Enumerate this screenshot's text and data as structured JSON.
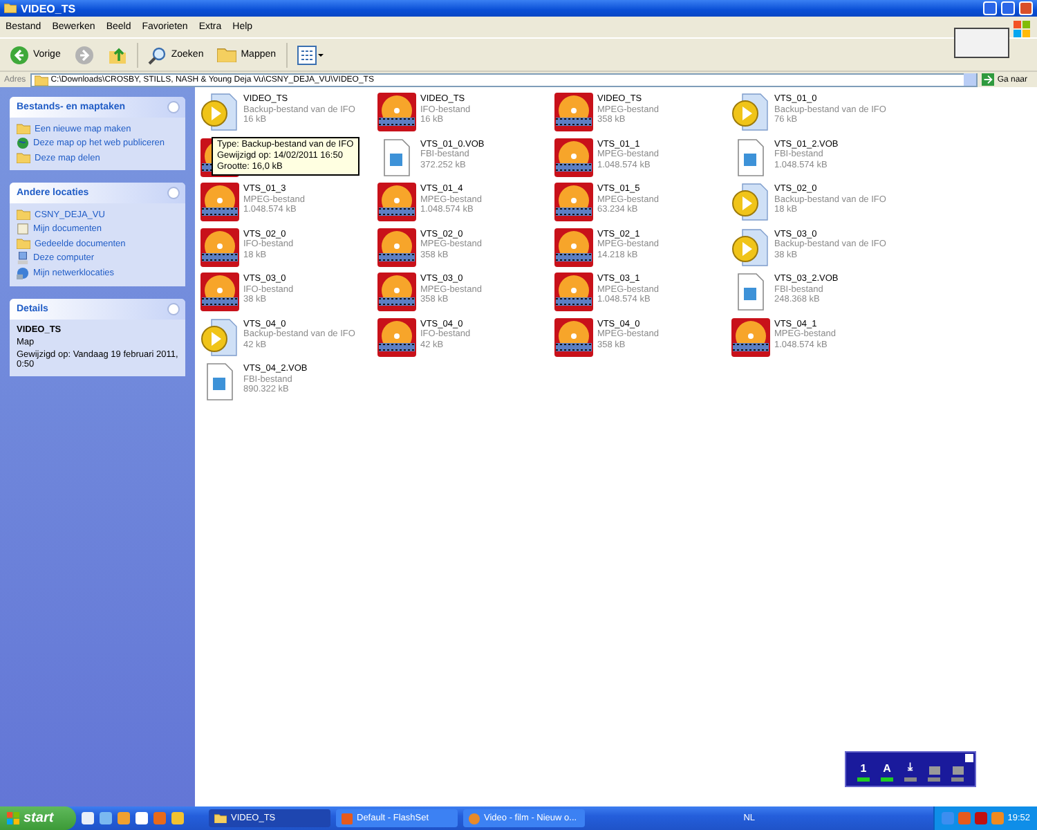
{
  "window": {
    "title": "VIDEO_TS"
  },
  "menu": [
    "Bestand",
    "Bewerken",
    "Beeld",
    "Favorieten",
    "Extra",
    "Help"
  ],
  "toolbar": [
    {
      "kind": "back",
      "label": "Vorige"
    },
    {
      "kind": "forward"
    },
    {
      "kind": "up"
    },
    {
      "kind": "search",
      "label": "Zoeken"
    },
    {
      "kind": "folders",
      "label": "Mappen"
    },
    {
      "kind": "views"
    }
  ],
  "address": {
    "label": "Adres",
    "value": "C:\\Downloads\\CROSBY, STILLS, NASH & Young Deja Vu\\CSNY_DEJA_VU\\VIDEO_TS",
    "go": "Ga naar"
  },
  "panels": [
    {
      "title": "Bestands- en maptaken",
      "items": [
        {
          "kind": "newfolder",
          "label": "Een nieuwe map maken"
        },
        {
          "kind": "web",
          "label": "Deze map op het web publiceren"
        },
        {
          "kind": "share",
          "label": "Deze map delen"
        }
      ]
    },
    {
      "title": "Andere locaties",
      "items": [
        {
          "kind": "folder",
          "label": "CSNY_DEJA_VU"
        },
        {
          "kind": "docs",
          "label": "Mijn documenten"
        },
        {
          "kind": "folder",
          "label": "Gedeelde documenten"
        },
        {
          "kind": "computer",
          "label": "Deze computer"
        },
        {
          "kind": "network",
          "label": "Mijn netwerklocaties"
        }
      ]
    }
  ],
  "details": {
    "title": "Details",
    "name": "VIDEO_TS",
    "type": "Map",
    "modified": "Gewijzigd op: Vandaag 19 februari 2011, 0:50"
  },
  "files": [
    {
      "kind": "play",
      "name": "VIDEO_TS",
      "type": "Backup-bestand van de IFO",
      "size": "16 kB"
    },
    {
      "kind": "media",
      "name": "VIDEO_TS",
      "type": "IFO-bestand",
      "size": "16 kB"
    },
    {
      "kind": "media",
      "name": "VIDEO_TS",
      "type": "MPEG-bestand",
      "size": "358 kB"
    },
    {
      "kind": "play",
      "name": "VTS_01_0",
      "type": "Backup-bestand van de IFO",
      "size": "76 kB"
    },
    {
      "kind": "media"
    },
    {
      "kind": "file",
      "name": "VTS_01_0.VOB",
      "type": "FBI-bestand",
      "size": "372.252 kB"
    },
    {
      "kind": "media",
      "name": "VTS_01_1",
      "type": "MPEG-bestand",
      "size": "1.048.574 kB"
    },
    {
      "kind": "file",
      "name": "VTS_01_2.VOB",
      "type": "FBI-bestand",
      "size": "1.048.574 kB"
    },
    {
      "kind": "media",
      "name": "VTS_01_3",
      "type": "MPEG-bestand",
      "size": "1.048.574 kB"
    },
    {
      "kind": "media",
      "name": "VTS_01_4",
      "type": "MPEG-bestand",
      "size": "1.048.574 kB"
    },
    {
      "kind": "media",
      "name": "VTS_01_5",
      "type": "MPEG-bestand",
      "size": "63.234 kB"
    },
    {
      "kind": "play",
      "name": "VTS_02_0",
      "type": "Backup-bestand van de IFO",
      "size": "18 kB"
    },
    {
      "kind": "media",
      "name": "VTS_02_0",
      "type": "IFO-bestand",
      "size": "18 kB"
    },
    {
      "kind": "media",
      "name": "VTS_02_0",
      "type": "MPEG-bestand",
      "size": "358 kB"
    },
    {
      "kind": "media",
      "name": "VTS_02_1",
      "type": "MPEG-bestand",
      "size": "14.218 kB"
    },
    {
      "kind": "play",
      "name": "VTS_03_0",
      "type": "Backup-bestand van de IFO",
      "size": "38 kB"
    },
    {
      "kind": "media",
      "name": "VTS_03_0",
      "type": "IFO-bestand",
      "size": "38 kB"
    },
    {
      "kind": "media",
      "name": "VTS_03_0",
      "type": "MPEG-bestand",
      "size": "358 kB"
    },
    {
      "kind": "media",
      "name": "VTS_03_1",
      "type": "MPEG-bestand",
      "size": "1.048.574 kB"
    },
    {
      "kind": "file",
      "name": "VTS_03_2.VOB",
      "type": "FBI-bestand",
      "size": "248.368 kB"
    },
    {
      "kind": "play",
      "name": "VTS_04_0",
      "type": "Backup-bestand van de IFO",
      "size": "42 kB"
    },
    {
      "kind": "media",
      "name": "VTS_04_0",
      "type": "IFO-bestand",
      "size": "42 kB"
    },
    {
      "kind": "media",
      "name": "VTS_04_0",
      "type": "MPEG-bestand",
      "size": "358 kB"
    },
    {
      "kind": "media",
      "name": "VTS_04_1",
      "type": "MPEG-bestand",
      "size": "1.048.574 kB"
    },
    {
      "kind": "file",
      "name": "VTS_04_2.VOB",
      "type": "FBI-bestand",
      "size": "890.322 kB"
    }
  ],
  "tooltip": [
    "Type: Backup-bestand van de IFO",
    "Gewijzigd op: 14/02/2011 16:50",
    "Grootte: 16,0 kB"
  ],
  "widget": [
    {
      "label": "1",
      "on": true
    },
    {
      "label": "A",
      "on": true
    },
    {
      "label": "⤓",
      "on": false
    },
    {
      "on": false
    },
    {
      "on": false
    }
  ],
  "taskbar": {
    "start": "start",
    "tasks": [
      {
        "label": "VIDEO_TS",
        "kind": "folder",
        "selected": true
      },
      {
        "label": "Default - FlashSet",
        "kind": "flash",
        "selected": false
      },
      {
        "label": "Video - film - Nieuw o...",
        "kind": "fox",
        "selected": false
      }
    ],
    "language": "NL",
    "time": "19:52"
  }
}
